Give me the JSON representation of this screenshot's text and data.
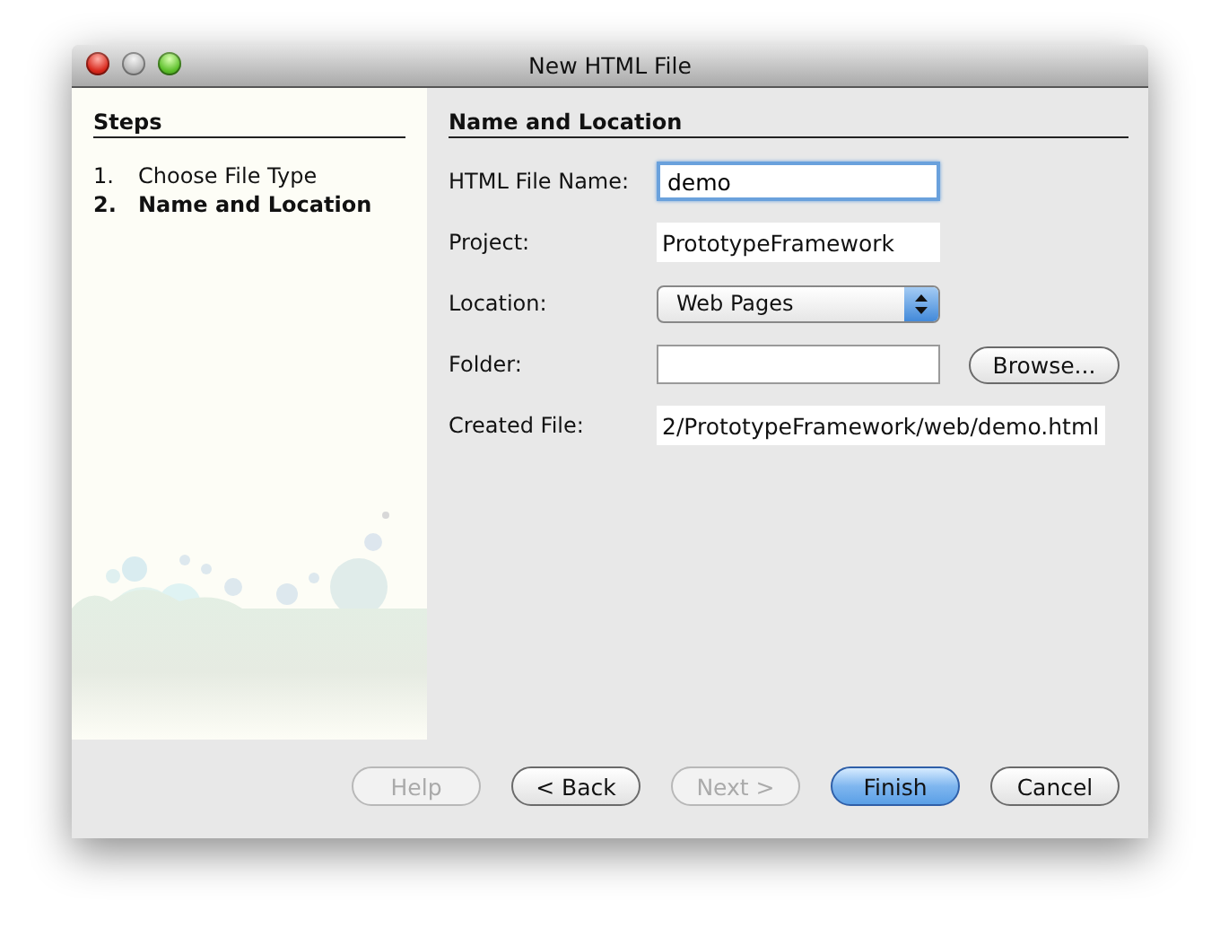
{
  "window": {
    "title": "New HTML File"
  },
  "steps": {
    "title": "Steps",
    "items": [
      {
        "number": "1.",
        "label": "Choose File Type",
        "selected": false
      },
      {
        "number": "2.",
        "label": "Name and Location",
        "selected": true
      }
    ]
  },
  "panel": {
    "title": "Name and Location",
    "fields": [
      {
        "kind": "input",
        "label": "HTML File Name:",
        "value": "demo",
        "focused": true
      },
      {
        "kind": "readonly",
        "label": "Project:",
        "value": "PrototypeFramework"
      },
      {
        "kind": "select",
        "label": "Location:",
        "value": "Web Pages"
      },
      {
        "kind": "input",
        "label": "Folder:",
        "focused": false,
        "button": "Browse..."
      },
      {
        "kind": "readonly",
        "label": "Created File:",
        "value": "2/PrototypeFramework/web/demo.html"
      }
    ]
  },
  "buttons": [
    {
      "label": "Help",
      "disabled": true,
      "default": false
    },
    {
      "label": "< Back",
      "disabled": false,
      "default": false
    },
    {
      "label": "Next >",
      "disabled": true,
      "default": false
    },
    {
      "label": "Finish",
      "disabled": false,
      "default": true
    },
    {
      "label": "Cancel",
      "disabled": false,
      "default": false
    }
  ]
}
